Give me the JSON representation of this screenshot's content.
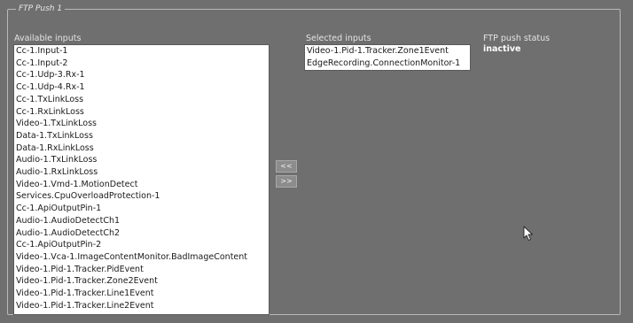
{
  "panel": {
    "legend": "FTP Push 1"
  },
  "available": {
    "label": "Available inputs",
    "items": [
      "Cc-1.Input-1",
      "Cc-1.Input-2",
      "Cc-1.Udp-3.Rx-1",
      "Cc-1.Udp-4.Rx-1",
      "Cc-1.TxLinkLoss",
      "Cc-1.RxLinkLoss",
      "Video-1.TxLinkLoss",
      "Data-1.TxLinkLoss",
      "Data-1.RxLinkLoss",
      "Audio-1.TxLinkLoss",
      "Audio-1.RxLinkLoss",
      "Video-1.Vmd-1.MotionDetect",
      "Services.CpuOverloadProtection-1",
      "Cc-1.ApiOutputPin-1",
      "Audio-1.AudioDetectCh1",
      "Audio-1.AudioDetectCh2",
      "Cc-1.ApiOutputPin-2",
      "Video-1.Vca-1.ImageContentMonitor.BadImageContent",
      "Video-1.Pid-1.Tracker.PidEvent",
      "Video-1.Pid-1.Tracker.Zone2Event",
      "Video-1.Pid-1.Tracker.Line1Event",
      "Video-1.Pid-1.Tracker.Line2Event"
    ]
  },
  "buttons": {
    "move_left": "<<",
    "move_right": ">>"
  },
  "selected": {
    "label": "Selected inputs",
    "items": [
      "Video-1.Pid-1.Tracker.Zone1Event",
      "EdgeRecording.ConnectionMonitor-1"
    ]
  },
  "status": {
    "label": "FTP push status",
    "value": "inactive"
  }
}
